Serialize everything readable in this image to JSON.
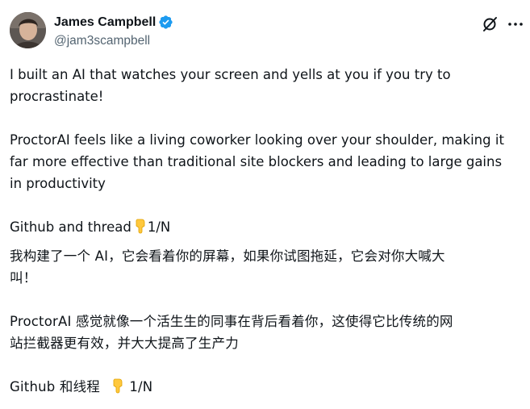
{
  "author": {
    "display_name": "James Campbell",
    "handle": "@jam3scampbell",
    "verified": true,
    "accent_color": "#1d9bf0"
  },
  "actions": {
    "grok_icon": "grok-icon",
    "more_icon": "more-horizontal-icon"
  },
  "tweet": {
    "en_line1": "I built an AI that watches your screen and yells at you if you try to",
    "en_line2": "procrastinate!",
    "en_p2_line1": "ProctorAI feels like a living coworker looking over your shoulder, making it",
    "en_p2_line2": "far more effective than traditional site blockers and leading to large gains",
    "en_p2_line3": "in productivity",
    "en_p3_prefix": "Github and thread",
    "en_p3_suffix": "1/N",
    "zh_line1": "我构建了一个 AI，它会看着你的屏幕，如果你试图拖延，它会对你大喊大",
    "zh_line2": "叫！",
    "zh_p2_line1": "ProctorAI 感觉就像一个活生生的同事在背后看着你，这使得它比传统的网",
    "zh_p2_line2": "站拦截器更有效，并大大提高了生产力",
    "zh_p3_prefix": "Github 和线程",
    "zh_p3_suffix": "1/N",
    "pointing_emoji": "backhand-index-pointing-down-emoji"
  }
}
